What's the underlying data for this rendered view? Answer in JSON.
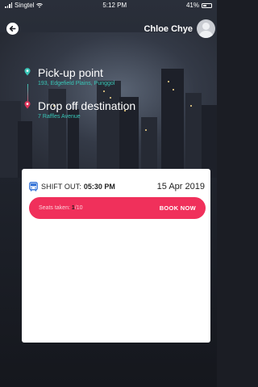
{
  "status_bar": {
    "carrier": "Singtel",
    "time": "5:12 PM",
    "battery": "41%"
  },
  "header": {
    "user_name": "Chloe Chye",
    "back_icon": "arrow-left-icon",
    "avatar_icon": "user-avatar-icon"
  },
  "route": {
    "pickup": {
      "title": "Pick-up point",
      "address": "193, Edgefield Plains, Punggol",
      "color": "#39c6b7"
    },
    "dropoff": {
      "title": "Drop off destination",
      "address": "7 Raffles Avenue",
      "color": "#e0345a"
    }
  },
  "shift": {
    "label": "SHIFT OUT:",
    "time": "05:30 PM",
    "date": "15 Apr 2019",
    "icon": "bus-icon"
  },
  "booking": {
    "seats_label": "Seats taken:",
    "seats_taken": "1",
    "seats_total": "/10",
    "button_label": "BOOK NOW",
    "accent_color": "#f0305b"
  }
}
